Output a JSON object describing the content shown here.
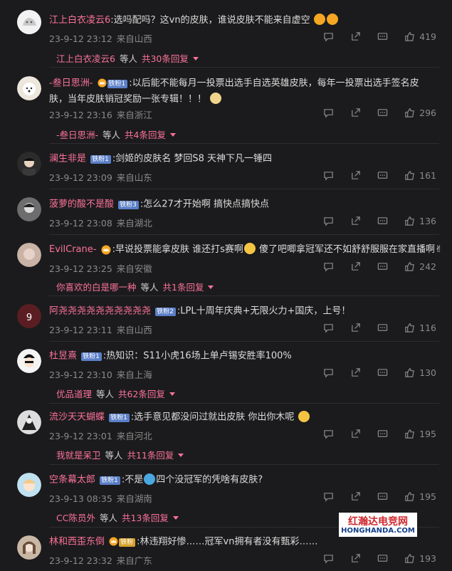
{
  "comments": [
    {
      "user": "江上白衣凌云6",
      "badge": "",
      "text": ":选吗配吗？这vn的皮肤，谁说皮肤不能来自虚空",
      "time": "23-9-12 23:12",
      "loc": "来自山西",
      "likes": "419",
      "reply": {
        "user": "江上白衣凌云6",
        "mid": "等人",
        "total": "共30条回复"
      }
    },
    {
      "user": "-叁日思洲-",
      "badge": "铁粉1",
      "text": ":以后能不能每月一投票出选手自选英雄皮肤，每年一投票出选手签名皮肤，当年皮肤销冠奖励一张专辑！！！",
      "time": "23-9-12 23:16",
      "loc": "来自浙江",
      "likes": "296",
      "reply": {
        "user": "-叁日思洲-",
        "mid": "等人",
        "total": "共4条回复"
      }
    },
    {
      "user": "澜生非是",
      "badge": "铁粉1",
      "text": ":剑姬的皮肤名 梦回S8 天神下凡一锤四",
      "time": "23-9-12 23:09",
      "loc": "来自山东",
      "likes": "161"
    },
    {
      "user": "菠萝的酸不是酸",
      "badge": "铁粉3",
      "text": ":怎么27才开始啊 搞快点搞快点",
      "time": "23-9-12 23:08",
      "loc": "来自湖北",
      "likes": "136"
    },
    {
      "user": "EvilCrane-",
      "badge": "",
      "text": ":早说投票能拿皮肤 谁还打s赛啊",
      "text2": " 傻了吧唧拿冠军还不如舒舒服服在家直播啊",
      "time": "23-9-12 23:25",
      "loc": "来自安徽",
      "likes": "242",
      "reply": {
        "user": "你喜欢的白是哪一种",
        "mid": "等人",
        "total": "共1条回复"
      }
    },
    {
      "user": "阿尧尧尧尧尧尧尧尧尧尧",
      "badge": "铁粉2",
      "text": ":LPL十周年庆典+无限火力+国庆，上号！",
      "time": "23-9-12 23:11",
      "loc": "来自山西",
      "likes": "116"
    },
    {
      "user": "杜昱熹",
      "badge": "铁粉1",
      "text": ":热知识：S11小虎16场上单卢锡安胜率100%",
      "time": "23-9-12 23:10",
      "loc": "来自上海",
      "likes": "130",
      "reply": {
        "user": "优品道理",
        "mid": "等人",
        "total": "共62条回复"
      }
    },
    {
      "user": "流沙天天蝴蝶",
      "badge": "铁粉1",
      "text": ":选手意见都没问过就出皮肤 你出你木呢",
      "time": "23-9-12 23:01",
      "loc": "来自河北",
      "likes": "195",
      "reply": {
        "user": "我就是呆卫",
        "mid": "等人",
        "total": "共11条回复"
      }
    },
    {
      "user": "空条幕太郎",
      "badge": "铁粉1",
      "text": ":不是",
      "text2": "四个没冠军的凭啥有皮肤?",
      "time": "23-9-13 08:35",
      "loc": "来自湖南",
      "likes": "195",
      "reply": {
        "user": "CC陈员外",
        "mid": "等人",
        "total": "共13条回复"
      }
    },
    {
      "user": "林和西歪东倒",
      "badge": "铁粉",
      "text": ":林违翔好惨……冠军vn拥有者没有甄彩……",
      "time": "23-9-12 23:32",
      "loc": "来自广东",
      "likes": "193"
    }
  ],
  "icons": {
    "comment": "comment-icon",
    "share": "share-icon",
    "more": "more-icon",
    "like": "thumbs-up-icon"
  },
  "watermark": {
    "line1": "红瀚达电竞网",
    "line2": "HONGHANDA.COM"
  },
  "colors": {
    "username": "#fb7299",
    "background": "#1b1b1d"
  }
}
